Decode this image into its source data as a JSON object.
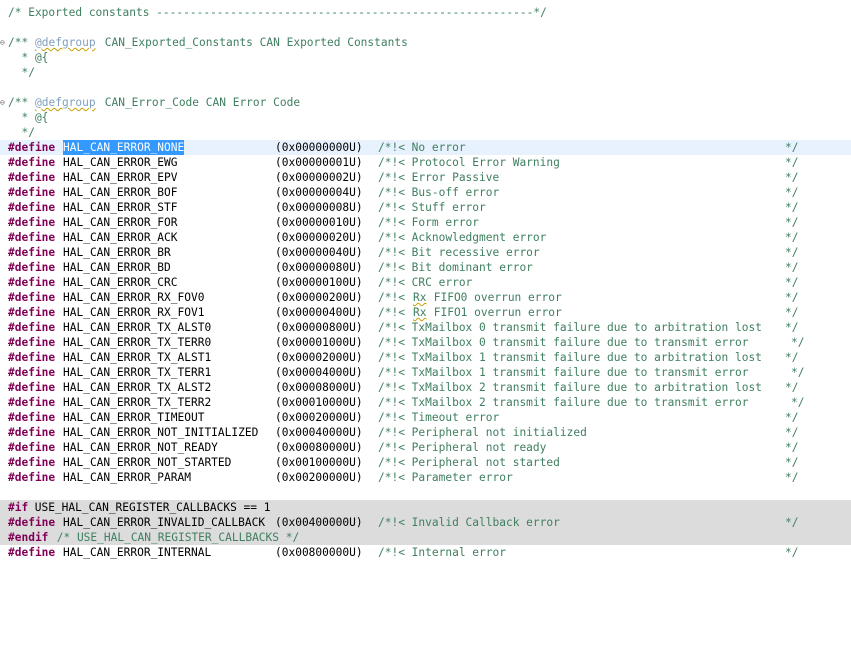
{
  "editor": {
    "header_comment": "/* Exported constants --------------------------------------------------------*/",
    "group1": {
      "open": "/** ",
      "tag": "@defgroup",
      "rest": " CAN_Exported_Constants CAN Exported Constants",
      "brace": "  * @{",
      "close": "  */"
    },
    "group2": {
      "open": "/** ",
      "tag": "@defgroup",
      "rest": " CAN_Error_Code CAN Error Code",
      "brace": "  * @{",
      "close": "  */"
    },
    "directive_define": "#define",
    "directive_if": "#if",
    "directive_endif": "#endif",
    "if_condition": " USE_HAL_CAN_REGISTER_CALLBACKS == 1",
    "endif_comment": " /* USE_HAL_CAN_REGISTER_CALLBACKS */",
    "comment_end": "*/",
    "defines": [
      {
        "name": "HAL_CAN_ERROR_NONE",
        "value": "(0x00000000U)",
        "comment": "/*!< No error",
        "selected": true
      },
      {
        "name": "HAL_CAN_ERROR_EWG",
        "value": "(0x00000001U)",
        "comment": "/*!< Protocol Error Warning"
      },
      {
        "name": "HAL_CAN_ERROR_EPV",
        "value": "(0x00000002U)",
        "comment": "/*!< Error Passive"
      },
      {
        "name": "HAL_CAN_ERROR_BOF",
        "value": "(0x00000004U)",
        "comment": "/*!< Bus-off error"
      },
      {
        "name": "HAL_CAN_ERROR_STF",
        "value": "(0x00000008U)",
        "comment": "/*!< Stuff error"
      },
      {
        "name": "HAL_CAN_ERROR_FOR",
        "value": "(0x00000010U)",
        "comment": "/*!< Form error"
      },
      {
        "name": "HAL_CAN_ERROR_ACK",
        "value": "(0x00000020U)",
        "comment": "/*!< Acknowledgment error"
      },
      {
        "name": "HAL_CAN_ERROR_BR",
        "value": "(0x00000040U)",
        "comment": "/*!< Bit recessive error"
      },
      {
        "name": "HAL_CAN_ERROR_BD",
        "value": "(0x00000080U)",
        "comment": "/*!< Bit dominant error"
      },
      {
        "name": "HAL_CAN_ERROR_CRC",
        "value": "(0x00000100U)",
        "comment": "/*!< CRC error"
      },
      {
        "name": "HAL_CAN_ERROR_RX_FOV0",
        "value": "(0x00000200U)",
        "comment_pre": "/*!< ",
        "comment_squig": "Rx",
        "comment_post": " FIFO0 overrun error"
      },
      {
        "name": "HAL_CAN_ERROR_RX_FOV1",
        "value": "(0x00000400U)",
        "comment_pre": "/*!< ",
        "comment_squig": "Rx",
        "comment_post": " FIFO1 overrun error"
      },
      {
        "name": "HAL_CAN_ERROR_TX_ALST0",
        "value": "(0x00000800U)",
        "comment": "/*!< TxMailbox 0 transmit failure due to arbitration lost"
      },
      {
        "name": "HAL_CAN_ERROR_TX_TERR0",
        "value": "(0x00001000U)",
        "comment": "/*!< TxMailbox 0 transmit failure due to transmit error"
      },
      {
        "name": "HAL_CAN_ERROR_TX_ALST1",
        "value": "(0x00002000U)",
        "comment": "/*!< TxMailbox 1 transmit failure due to arbitration lost"
      },
      {
        "name": "HAL_CAN_ERROR_TX_TERR1",
        "value": "(0x00004000U)",
        "comment": "/*!< TxMailbox 1 transmit failure due to transmit error"
      },
      {
        "name": "HAL_CAN_ERROR_TX_ALST2",
        "value": "(0x00008000U)",
        "comment": "/*!< TxMailbox 2 transmit failure due to arbitration lost"
      },
      {
        "name": "HAL_CAN_ERROR_TX_TERR2",
        "value": "(0x00010000U)",
        "comment": "/*!< TxMailbox 2 transmit failure due to transmit error"
      },
      {
        "name": "HAL_CAN_ERROR_TIMEOUT",
        "value": "(0x00020000U)",
        "comment": "/*!< Timeout error"
      },
      {
        "name": "HAL_CAN_ERROR_NOT_INITIALIZED",
        "value": "(0x00040000U)",
        "comment": "/*!< Peripheral not initialized"
      },
      {
        "name": "HAL_CAN_ERROR_NOT_READY",
        "value": "(0x00080000U)",
        "comment": "/*!< Peripheral not ready"
      },
      {
        "name": "HAL_CAN_ERROR_NOT_STARTED",
        "value": "(0x00100000U)",
        "comment": "/*!< Peripheral not started"
      },
      {
        "name": "HAL_CAN_ERROR_PARAM",
        "value": "(0x00200000U)",
        "comment": "/*!< Parameter error"
      }
    ],
    "callback_define": {
      "name": "HAL_CAN_ERROR_INVALID_CALLBACK",
      "value": "(0x00400000U)",
      "comment": "/*!< Invalid Callback error"
    },
    "last_define": {
      "name": "HAL_CAN_ERROR_INTERNAL",
      "value": "(0x00800000U)",
      "comment": "/*!< Internal error"
    }
  }
}
